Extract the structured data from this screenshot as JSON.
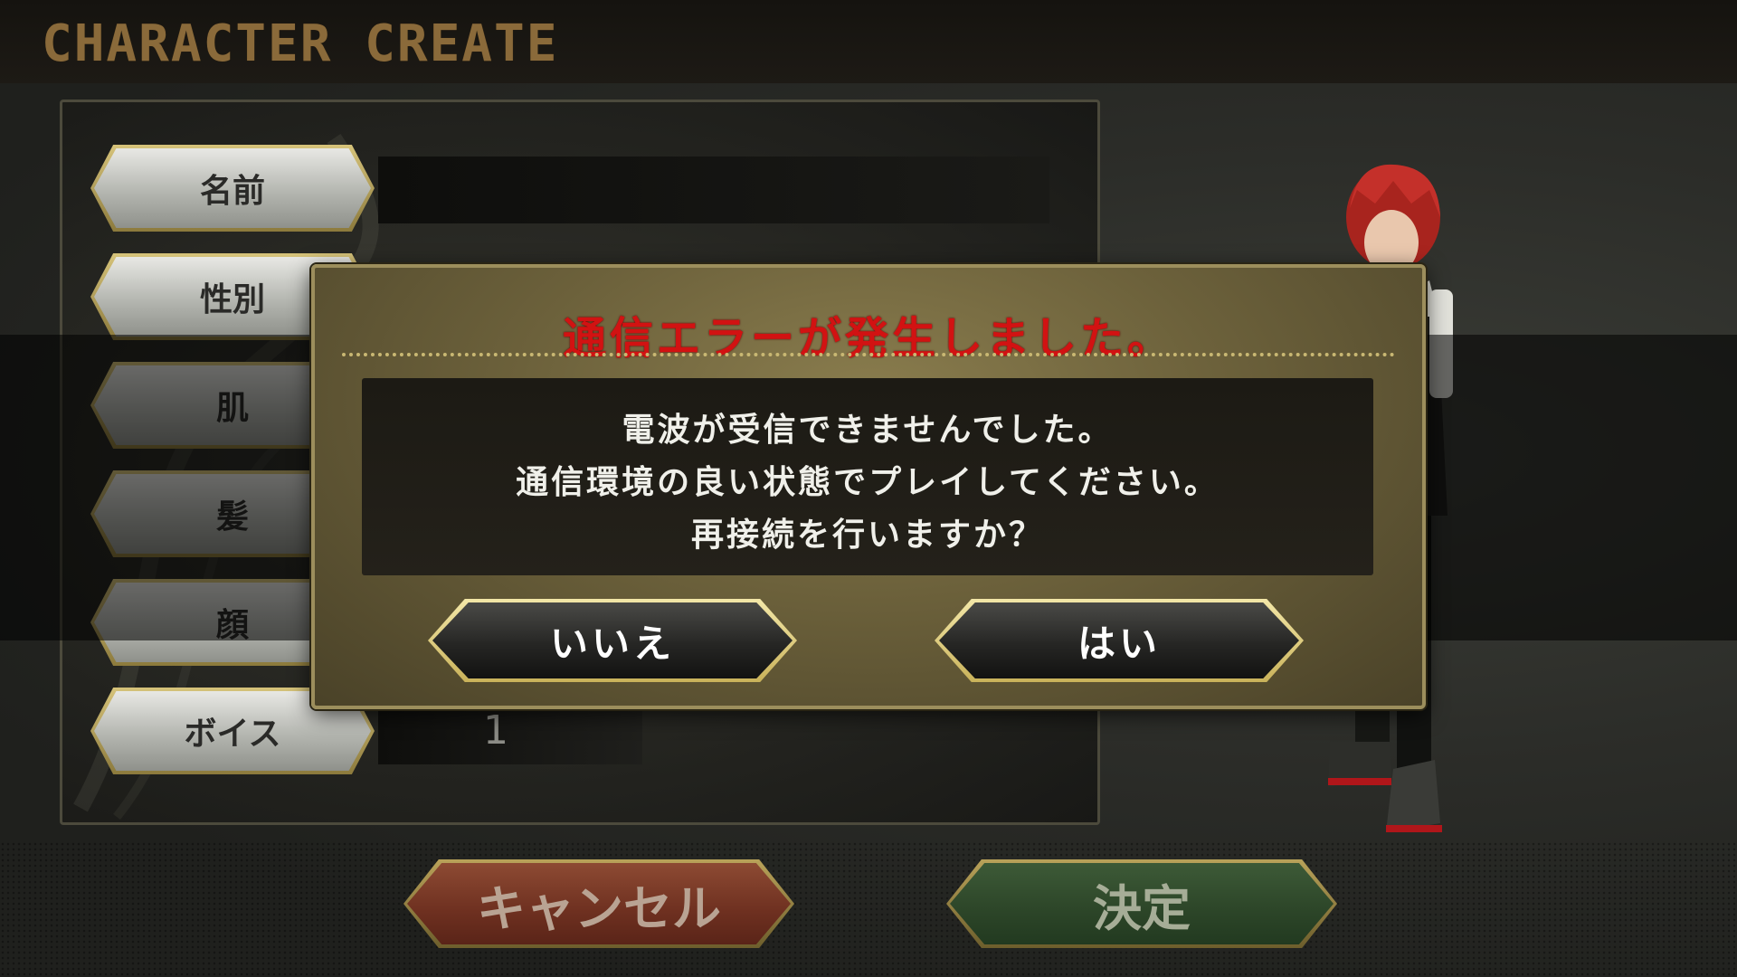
{
  "header": {
    "title": "CHARACTER CREATE"
  },
  "form": {
    "fields": [
      {
        "label": "名前"
      },
      {
        "label": "性別"
      },
      {
        "label": "肌"
      },
      {
        "label": "髪"
      },
      {
        "label": "顔"
      },
      {
        "label": "ボイス",
        "value": "1"
      }
    ]
  },
  "footer": {
    "cancel_label": "キャンセル",
    "confirm_label": "決定"
  },
  "dialog": {
    "title": "通信エラーが発生しました。",
    "lines": [
      "電波が受信できませんでした。",
      "通信環境の良い状態でプレイしてください。",
      "再接続を行いますか？"
    ],
    "no_label": "いいえ",
    "yes_label": "はい"
  },
  "colors": {
    "title_accent": "#8a6a3a",
    "error_red": "#d21212",
    "dialog_gold": "#9c8e5c",
    "cancel_red": "#6e3020",
    "confirm_green": "#2c4528"
  }
}
